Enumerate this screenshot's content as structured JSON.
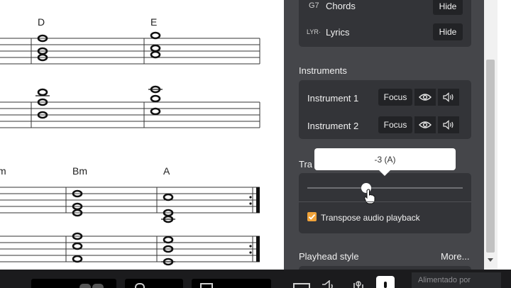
{
  "score": {
    "chords": [
      {
        "id": "D",
        "label": "D"
      },
      {
        "id": "E",
        "label": "E"
      },
      {
        "id": "m",
        "label": "m"
      },
      {
        "id": "Bm",
        "label": "Bm"
      },
      {
        "id": "A",
        "label": "A"
      }
    ]
  },
  "panel": {
    "chords_row": {
      "prefix": "G7",
      "label": "Chords",
      "button": "Hide"
    },
    "lyrics_row": {
      "prefix": "LYR·",
      "label": "Lyrics",
      "button": "Hide"
    },
    "instruments": {
      "title": "Instruments",
      "items": [
        {
          "label": "Instrument 1",
          "focus": "Focus"
        },
        {
          "label": "Instrument 2",
          "focus": "Focus"
        }
      ]
    },
    "transpose": {
      "title": "Tra",
      "tooltip": "-3 (A)",
      "value_fraction": 0.38,
      "checkbox_label": "Transpose audio playback",
      "checked": true
    },
    "playhead": {
      "title": "Playhead style",
      "more": "More..."
    }
  },
  "bottombar": {
    "powered_by": "Alimentado por"
  },
  "colors": {
    "accent": "#f0a33a",
    "panel_bg": "#45464a",
    "card_bg": "#333438"
  },
  "icons": [
    "eye-icon",
    "speaker-icon",
    "checkbox-check-icon",
    "hand-cursor-icon",
    "scroll-down-arrow-icon"
  ]
}
